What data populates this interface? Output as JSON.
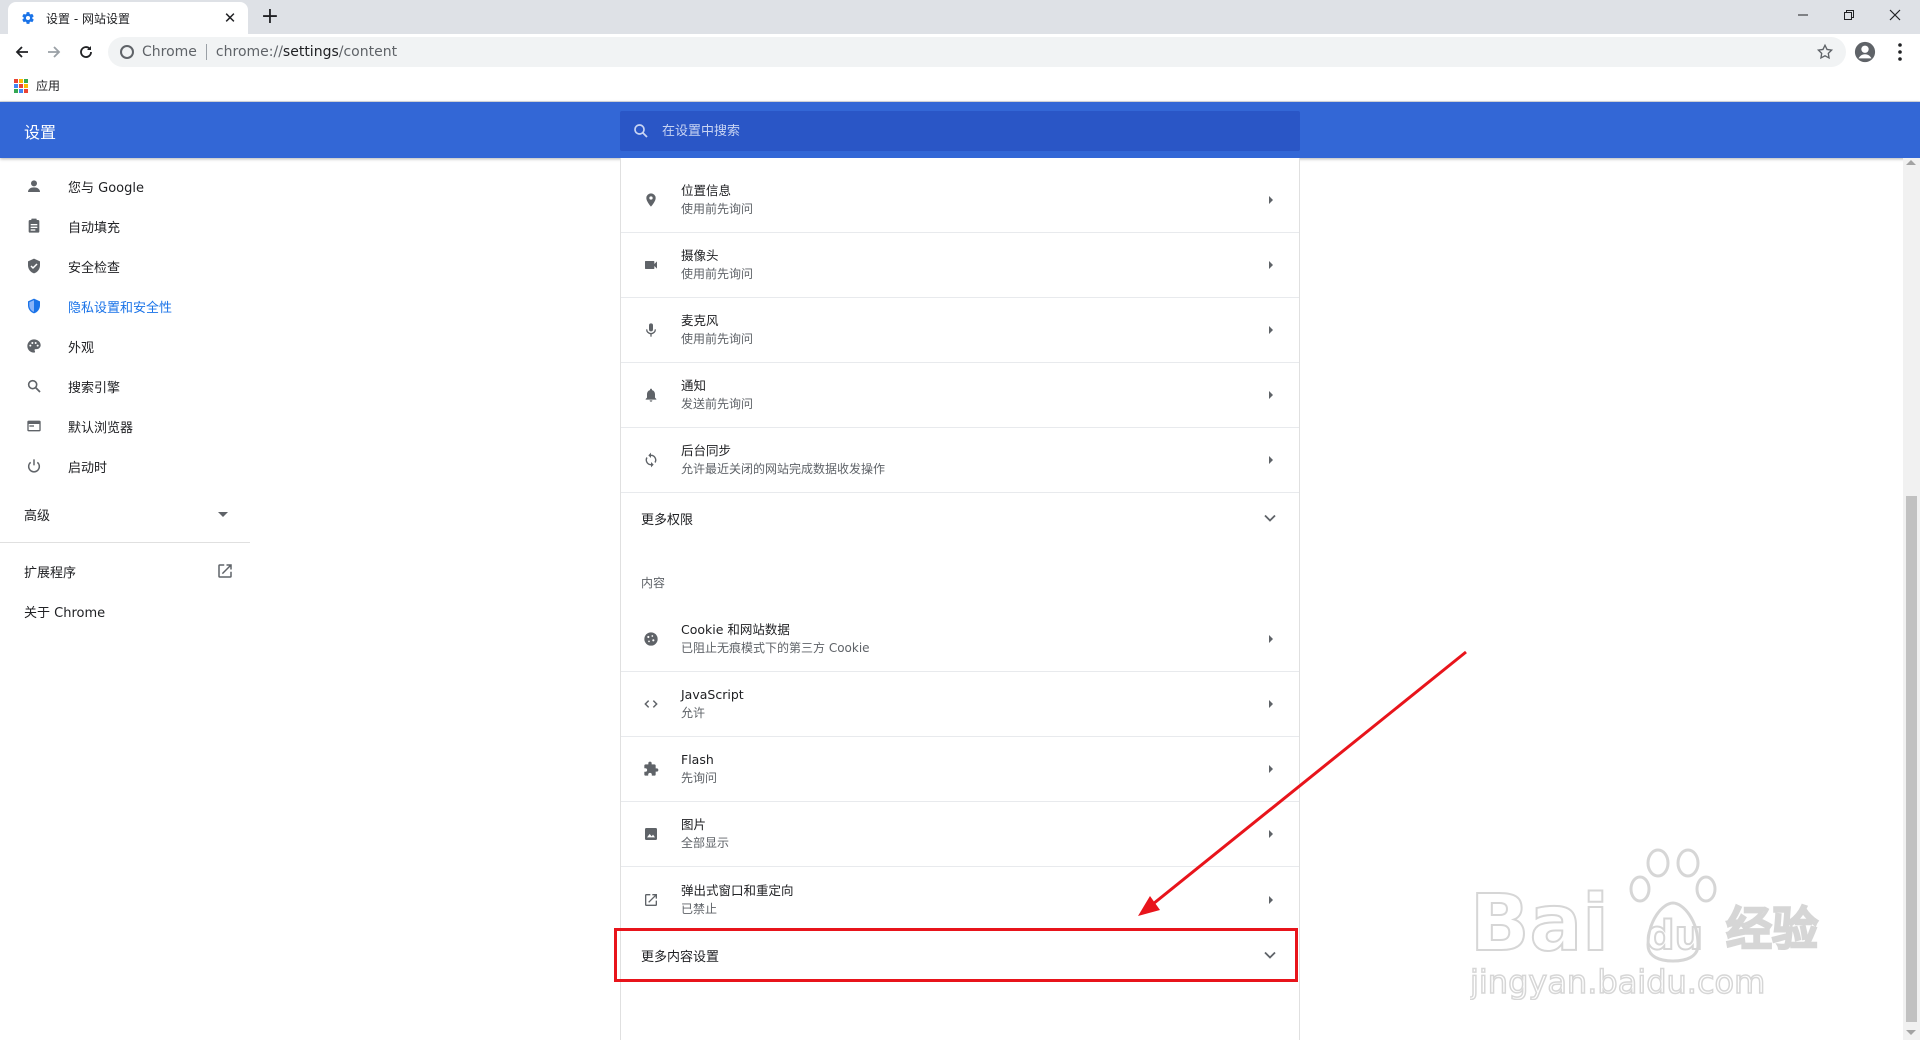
{
  "window": {
    "tab_title": "设置 - 网站设置",
    "new_tab": "+",
    "minimize": "—",
    "restore": "❐",
    "close": "✕",
    "tab_close": "✕"
  },
  "toolbar": {
    "chip": "Chrome",
    "url_prefix": "chrome://",
    "url_main": "settings",
    "url_suffix": "/content"
  },
  "bookmarks": {
    "apps_label": "应用",
    "apps_colors": [
      "#ea4335",
      "#fbbc04",
      "#34a853",
      "#4285f4",
      "#ea4335",
      "#fbbc04",
      "#34a853",
      "#4285f4",
      "#ea4335"
    ]
  },
  "header": {
    "title": "设置",
    "search_placeholder": "在设置中搜索"
  },
  "sidebar": {
    "items": [
      {
        "label": "您与 Google",
        "icon": "person-icon"
      },
      {
        "label": "自动填充",
        "icon": "clipboard-icon"
      },
      {
        "label": "安全检查",
        "icon": "shield-check-icon"
      },
      {
        "label": "隐私设置和安全性",
        "icon": "shield-privacy-icon",
        "active": true
      },
      {
        "label": "外观",
        "icon": "palette-icon"
      },
      {
        "label": "搜索引擎",
        "icon": "search-icon"
      },
      {
        "label": "默认浏览器",
        "icon": "browser-icon"
      },
      {
        "label": "启动时",
        "icon": "power-icon"
      }
    ],
    "advanced": "高级",
    "extensions": "扩展程序",
    "about": "关于 Chrome"
  },
  "content": {
    "permissions": [
      {
        "title": "位置信息",
        "sub": "使用前先询问",
        "icon": "location-icon"
      },
      {
        "title": "摄像头",
        "sub": "使用前先询问",
        "icon": "camera-icon"
      },
      {
        "title": "麦克风",
        "sub": "使用前先询问",
        "icon": "mic-icon"
      },
      {
        "title": "通知",
        "sub": "发送前先询问",
        "icon": "bell-icon"
      },
      {
        "title": "后台同步",
        "sub": "允许最近关闭的网站完成数据收发操作",
        "icon": "sync-icon"
      }
    ],
    "more_permissions": "更多权限",
    "section_content": "内容",
    "content_items": [
      {
        "title": "Cookie 和网站数据",
        "sub": "已阻止无痕模式下的第三方 Cookie",
        "icon": "cookie-icon"
      },
      {
        "title": "JavaScript",
        "sub": "允许",
        "icon": "code-icon"
      },
      {
        "title": "Flash",
        "sub": "先询问",
        "icon": "puzzle-icon"
      },
      {
        "title": "图片",
        "sub": "全部显示",
        "icon": "image-icon"
      },
      {
        "title": "弹出式窗口和重定向",
        "sub": "已禁止",
        "icon": "popup-icon"
      }
    ],
    "more_content": "更多内容设置"
  },
  "annotation": {
    "highlight_color": "#e8141b"
  },
  "watermark": {
    "brand": "Bai",
    "brand2": "du",
    "brand3": "经验",
    "url": "jingyan.baidu.com"
  }
}
